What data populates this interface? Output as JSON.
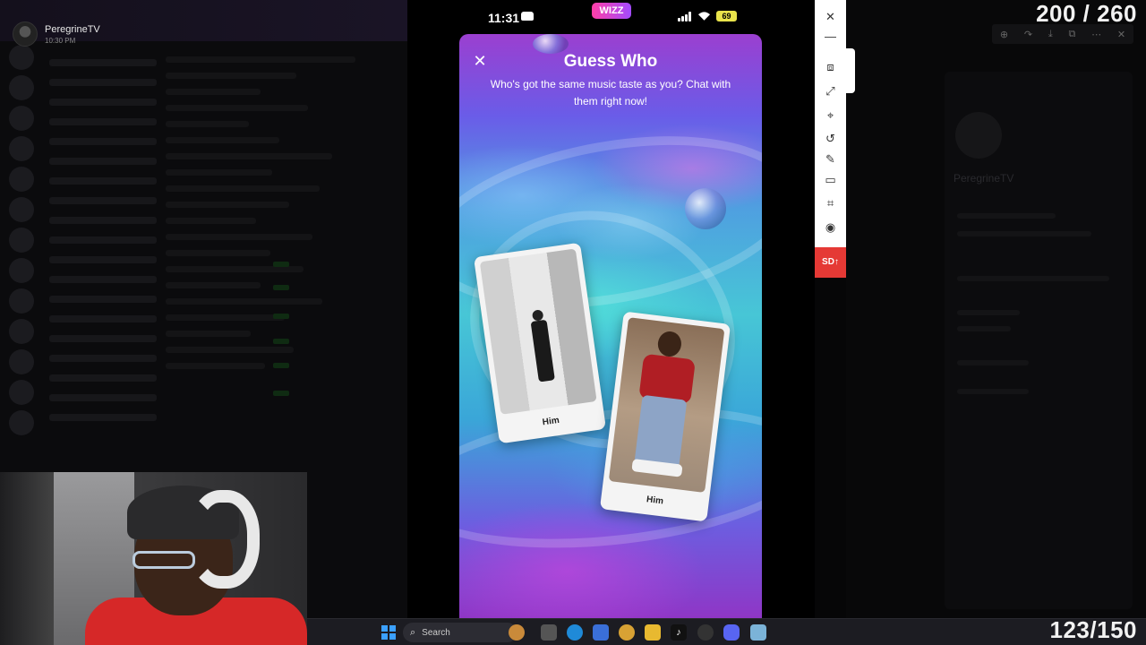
{
  "stream": {
    "username": "PeregrineTV",
    "timestamp": "10:30 PM",
    "counter_top": "200 / 260",
    "counter_bottom": "123/150"
  },
  "phone": {
    "status": {
      "time": "11:31",
      "app_badge": "WIZZ",
      "battery": "69"
    },
    "modal": {
      "title": "Guess Who",
      "subtitle": "Who's got the same music taste as you? Chat with them right now!",
      "cards": [
        {
          "label": "Him"
        },
        {
          "label": "Him"
        }
      ]
    }
  },
  "side_toolbar": {
    "sd_label": "SD",
    "tools": [
      "screenshot-icon",
      "fullscreen-icon",
      "pin-icon",
      "rotate-icon",
      "pen-icon",
      "split-icon",
      "crop-icon",
      "record-icon"
    ]
  },
  "profile_pane": {
    "name": "PeregrineTV"
  },
  "taskbar": {
    "search_label": "Search"
  },
  "colors": {
    "accent_red": "#e53935",
    "battery": "#e9e34b",
    "windows_blue": "#3ba0ff"
  }
}
